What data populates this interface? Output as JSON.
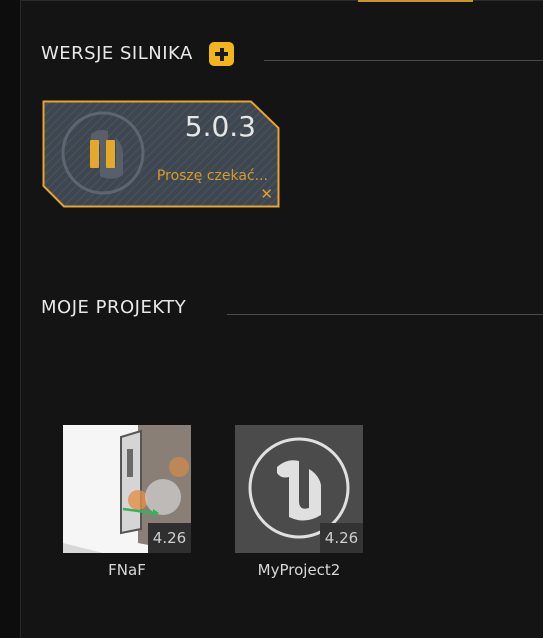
{
  "engine_section": {
    "title": "WERSJE SILNIKA",
    "add_icon": "plus-icon",
    "engines": [
      {
        "version": "5.0.3",
        "status": "Proszę czekać...",
        "state_icon": "pause-icon",
        "cancel_icon": "close-icon",
        "accent": "#f3b51c"
      }
    ]
  },
  "projects_section": {
    "title": "MOJE PROJEKTY",
    "projects": [
      {
        "name": "FNaF",
        "version": "4.26",
        "thumbnail": "scene-thumbnail"
      },
      {
        "name": "MyProject2",
        "version": "4.26",
        "thumbnail": "unreal-logo-icon"
      }
    ]
  }
}
